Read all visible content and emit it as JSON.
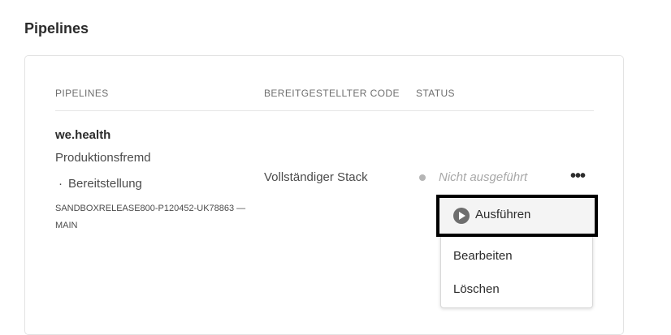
{
  "page": {
    "title": "Pipelines"
  },
  "table": {
    "headers": {
      "pipelines": "PIPELINES",
      "deployed_code": "BEREITGESTELLTER CODE",
      "status": "STATUS"
    },
    "row": {
      "name": "we.health",
      "environment": "Produktionsfremd",
      "bullet": "·",
      "type": "Bereitstellung",
      "repo": "SANDBOXRELEASE800-P120452-UK78863 — MAIN",
      "deployed_code": "Vollständiger Stack",
      "status": "Nicht ausgeführt",
      "more_actions_glyph": "•••"
    }
  },
  "menu": {
    "items": {
      "run": "Ausführen",
      "edit": "Bearbeiten",
      "delete": "Löschen"
    }
  },
  "icons": {
    "run": "play-circle-icon",
    "status": "status-dot-icon",
    "more": "more-icon"
  },
  "colors": {
    "status_dot": "#b5b5b5",
    "focus_border": "#000000",
    "highlight_bg": "#f4f4f4"
  }
}
